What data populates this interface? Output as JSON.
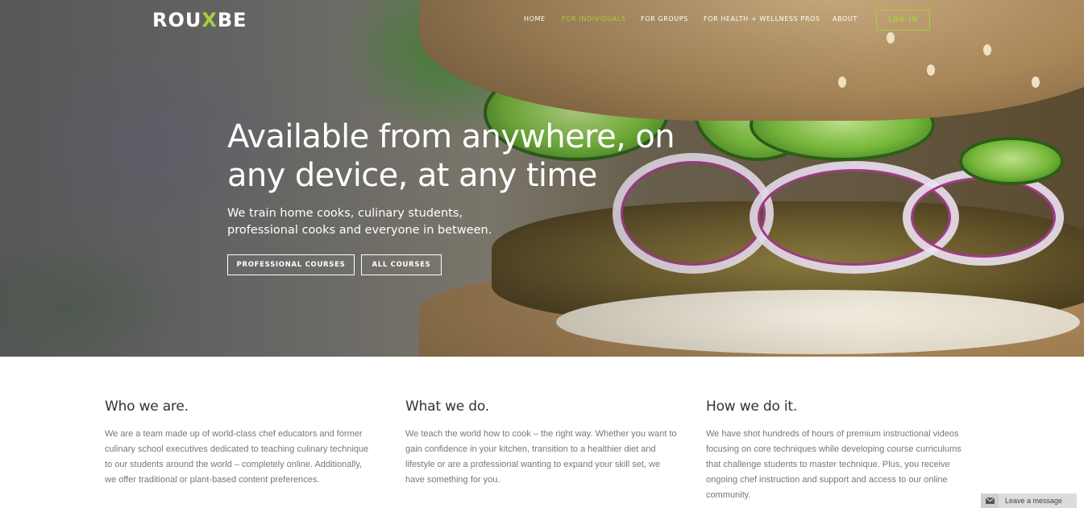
{
  "brand": {
    "logo_pre": "ROU",
    "logo_x": "X",
    "logo_post": "BE",
    "accent_color": "#a8cf3c"
  },
  "nav": {
    "items": [
      {
        "label": "HOME",
        "active": false
      },
      {
        "label": "FOR INDIVIDUALS",
        "active": true
      },
      {
        "label": "FOR GROUPS",
        "active": false
      },
      {
        "label": "FOR HEALTH + WELLNESS PROS",
        "active": false
      },
      {
        "label": "ABOUT",
        "active": false
      }
    ],
    "login_label": "LOG IN"
  },
  "hero": {
    "title": "Available from anywhere, on any device, at any time",
    "subtitle": "We train home cooks, culinary students, professional cooks and everyone in between.",
    "btn_professional": "PROFESSIONAL COURSES",
    "btn_all": "ALL COURSES"
  },
  "columns": [
    {
      "heading": "Who we are.",
      "body": "We are a team made up of world-class chef educators and former culinary school executives dedicated to teaching culinary technique to our students around the world – completely online. Additionally, we offer traditional or plant-based content preferences."
    },
    {
      "heading": "What we do.",
      "body": "We teach the world how to cook – the right way. Whether you want to gain confidence in your kitchen, transition to a healthier diet and lifestyle or are a professional wanting to expand your skill set, we have something for you."
    },
    {
      "heading": "How we do it.",
      "body": "We have shot hundreds of hours of premium instructional videos focusing on core techniques while developing course curriculums that challenge students to master technique. Plus, you receive ongoing chef instruction and support and access to our online community."
    }
  ],
  "chat": {
    "label": "Leave a message",
    "icon": "envelope-icon"
  }
}
